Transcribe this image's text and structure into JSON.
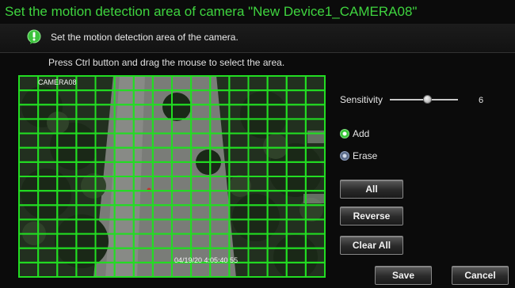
{
  "window": {
    "title": "Set the motion detection area of camera \"New Device1_CAMERA08\""
  },
  "header": {
    "icon": "info-bubble-icon",
    "text": "Set the motion detection area of the camera."
  },
  "instruction": "Press Ctrl button and drag the mouse to select the area.",
  "video": {
    "camera_label": "CAMERA08",
    "timestamp": "04/19/20 4:05:40 55",
    "grid": {
      "columns": 16,
      "rows": 14,
      "all_selected": true
    },
    "grid_color": "#22dd22"
  },
  "sensitivity": {
    "label": "Sensitivity",
    "value": "6",
    "fraction": 0.55
  },
  "mode": {
    "options": [
      {
        "label": "Add",
        "selected": true
      },
      {
        "label": "Erase",
        "selected": false
      }
    ]
  },
  "buttons": {
    "all": "All",
    "reverse": "Reverse",
    "clear_all": "Clear All",
    "save": "Save",
    "cancel": "Cancel"
  },
  "colors": {
    "title": "#3fd43f",
    "background": "#0b0b0b"
  }
}
